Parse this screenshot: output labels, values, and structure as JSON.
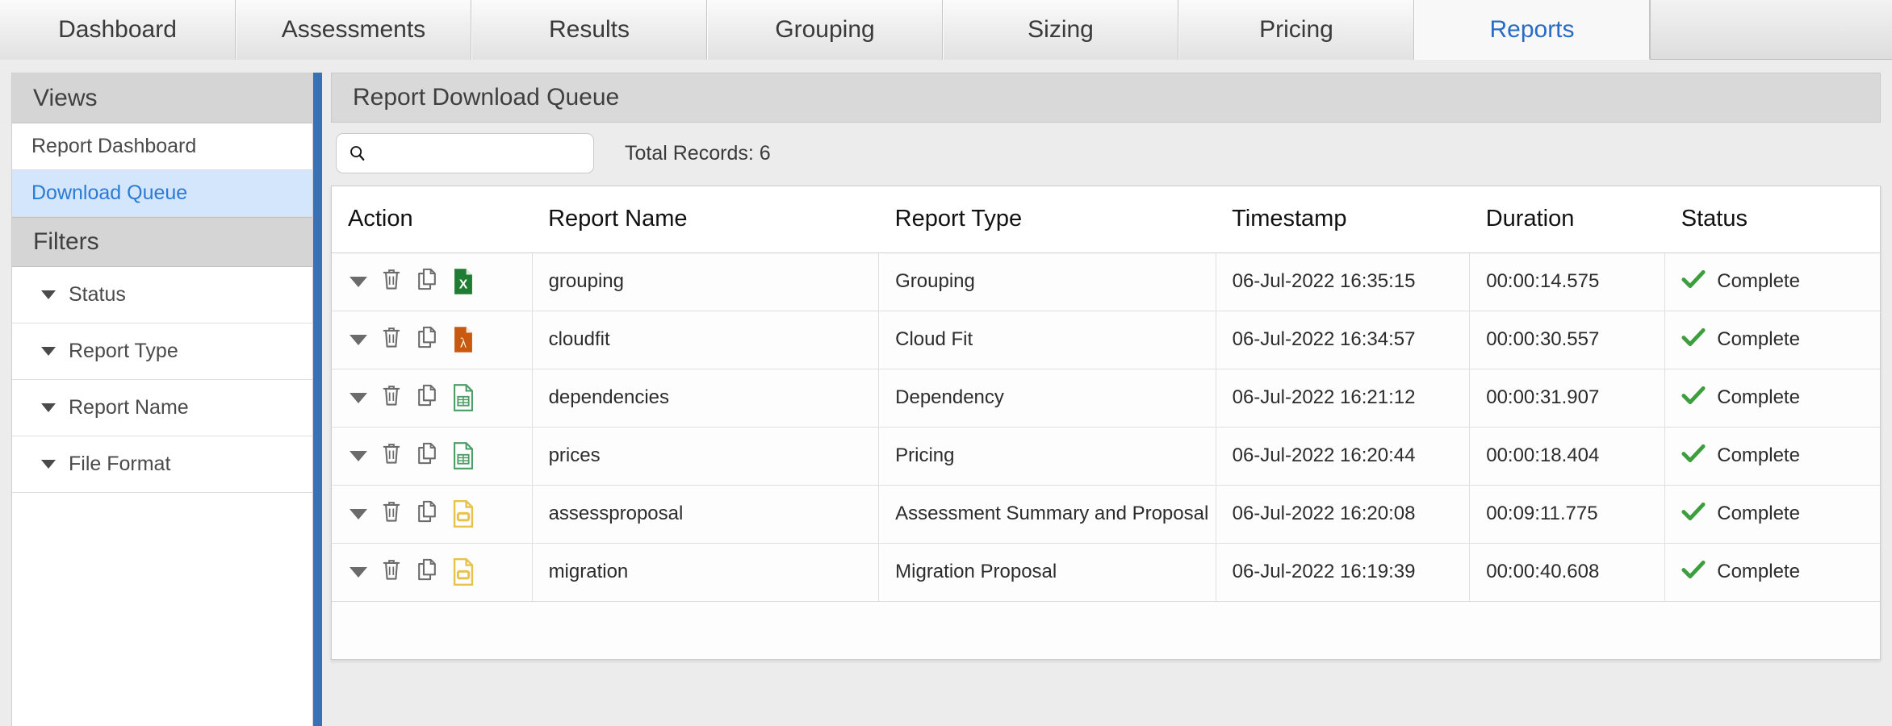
{
  "tabs": [
    {
      "label": "Dashboard",
      "active": false
    },
    {
      "label": "Assessments",
      "active": false
    },
    {
      "label": "Results",
      "active": false
    },
    {
      "label": "Grouping",
      "active": false
    },
    {
      "label": "Sizing",
      "active": false
    },
    {
      "label": "Pricing",
      "active": false
    },
    {
      "label": "Reports",
      "active": true
    }
  ],
  "sidebar": {
    "views_header": "Views",
    "views": [
      {
        "label": "Report Dashboard",
        "selected": false
      },
      {
        "label": "Download Queue",
        "selected": true
      }
    ],
    "filters_header": "Filters",
    "filters": [
      {
        "label": "Status"
      },
      {
        "label": "Report Type"
      },
      {
        "label": "Report Name"
      },
      {
        "label": "File Format"
      }
    ]
  },
  "main": {
    "title": "Report Download Queue",
    "search": {
      "value": "",
      "placeholder": ""
    },
    "total_records_label": "Total Records: 6"
  },
  "table": {
    "columns": [
      "Action",
      "Report Name",
      "Report Type",
      "Timestamp",
      "Duration",
      "Status"
    ],
    "rows": [
      {
        "file_format": "excel",
        "report_name": "grouping",
        "report_type": "Grouping",
        "timestamp": "06-Jul-2022 16:35:15",
        "duration": "00:00:14.575",
        "status": "Complete"
      },
      {
        "file_format": "pdf",
        "report_name": "cloudfit",
        "report_type": "Cloud Fit",
        "timestamp": "06-Jul-2022 16:34:57",
        "duration": "00:00:30.557",
        "status": "Complete"
      },
      {
        "file_format": "csv",
        "report_name": "dependencies",
        "report_type": "Dependency",
        "timestamp": "06-Jul-2022 16:21:12",
        "duration": "00:00:31.907",
        "status": "Complete"
      },
      {
        "file_format": "csv",
        "report_name": "prices",
        "report_type": "Pricing",
        "timestamp": "06-Jul-2022 16:20:44",
        "duration": "00:00:18.404",
        "status": "Complete"
      },
      {
        "file_format": "slides",
        "report_name": "assessproposal",
        "report_type": "Assessment Summary and Proposal",
        "timestamp": "06-Jul-2022 16:20:08",
        "duration": "00:09:11.775",
        "status": "Complete"
      },
      {
        "file_format": "slides",
        "report_name": "migration",
        "report_type": "Migration Proposal",
        "timestamp": "06-Jul-2022 16:19:39",
        "duration": "00:00:40.608",
        "status": "Complete"
      }
    ]
  },
  "icons": {
    "search": "search-icon",
    "delete": "trash-icon",
    "copy": "copy-icon",
    "expand": "chevron-down-icon",
    "status_complete": "check-icon",
    "file_excel": "excel-file-icon",
    "file_pdf": "pdf-file-icon",
    "file_csv": "spreadsheet-file-icon",
    "file_slides": "presentation-file-icon"
  },
  "colors": {
    "accent_blue": "#3771b8",
    "active_tab_text": "#2a6bc4",
    "selected_row_bg": "#d3e6fb",
    "status_green": "#3d9e3d",
    "excel_green": "#1e7d32",
    "pdf_orange": "#c85a10",
    "csv_green": "#4a9c63",
    "slides_yellow": "#e8c349"
  }
}
